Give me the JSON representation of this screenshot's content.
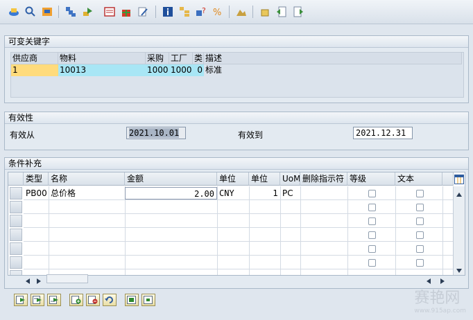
{
  "section_key": {
    "title": "可变关键字",
    "headers": [
      "供应商",
      "物料",
      "采购",
      "工厂",
      "类",
      "描述"
    ],
    "row": [
      "1",
      "10013",
      "1000",
      "1000",
      "0",
      "标准"
    ]
  },
  "section_validity": {
    "title": "有效性",
    "from_label": "有效从",
    "from_value": "2021.10.01",
    "to_label": "有效到",
    "to_value": "2021.12.31"
  },
  "section_conditions": {
    "title": "条件补充",
    "headers": [
      "类型",
      "名称",
      "金额",
      "单位",
      "单位",
      "UoM",
      "删除指示符",
      "等级",
      "文本"
    ],
    "rows": [
      {
        "type": "PB00",
        "name": "总价格",
        "amount": "2.00",
        "unit": "CNY",
        "per": "1",
        "uom": "PC"
      }
    ]
  },
  "watermark": {
    "text": "赛艳网",
    "url": "www.915ap.com"
  }
}
